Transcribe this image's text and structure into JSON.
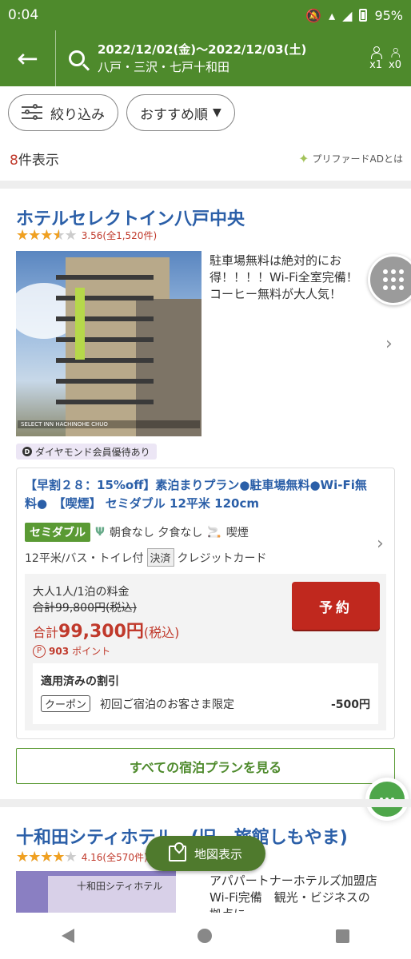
{
  "status": {
    "time": "0:04",
    "battery": "95%"
  },
  "header": {
    "dates": "2022/12/02(金)〜2022/12/03(土)",
    "area": "八戸・三沢・七戸十和田",
    "adults": "x1",
    "children": "x0"
  },
  "filters": {
    "refine_label": "絞り込み",
    "sort_label": "おすすめ順"
  },
  "results": {
    "count": "8",
    "count_suffix": "件表示",
    "pref_ad": "プリファードADとは"
  },
  "hotels": [
    {
      "name": "ホテルセレクトイン八戸中央",
      "rating": 3.56,
      "rating_text": "3.56(全1,520件)",
      "description": "駐車場無料は絶対的にお得！！！！Wi-Fi全室完備！コーヒー無料が大人気！",
      "photo_sign": "SELECT INN HACHINOHE CHUO",
      "badge": "ダイヤモンド会員優待あり",
      "plan": {
        "title": "【早割２８：15%off】素泊まりプラン●駐車場無料●Wi-Fi無料●　【喫煙】 セミダブル 12平米 120cm",
        "room_tag": "セミダブル",
        "meal": "朝食なし 夕食なし",
        "smoking": "喫煙",
        "room_info": "12平米/バス・トイレ付",
        "payment_tag": "決済",
        "payment": "クレジットカード",
        "price_label": "大人1人/1泊の料金",
        "price_old": "合計99,800円(税込)",
        "price_prefix": "合計",
        "price_total": "99,300円",
        "price_tax": "(税込)",
        "points": "903",
        "points_unit": "ポイント",
        "reserve_label": "予約",
        "discount_title": "適用済みの割引",
        "coupon_label": "クーポン",
        "coupon_desc": "初回ご宿泊のお客さま限定",
        "coupon_amount": "-500円"
      },
      "all_plans_label": "すべての宿泊プランを見る"
    },
    {
      "name": "十和田シティホテル　(旧　旅館しもやま)",
      "rating": 4.16,
      "rating_text": "4.16(全570件)",
      "photo_text": "十和田シティホテル",
      "description": "アパパートナーホテルズ加盟店　Wi-Fi完備　観光・ビジネスの拠点に"
    }
  ],
  "map_button": "地図表示",
  "colors": {
    "header_green": "#4e8a2c",
    "link_blue": "#2b5fa8",
    "price_red": "#c0392b",
    "reserve_red": "#c0281e"
  }
}
